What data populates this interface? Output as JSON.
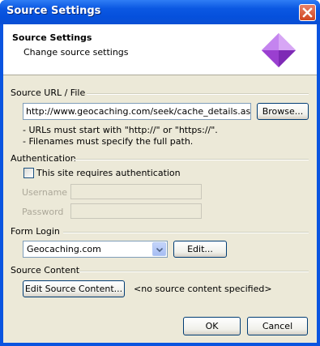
{
  "window": {
    "title": "Source Settings"
  },
  "header": {
    "title": "Source Settings",
    "subtitle": "Change source settings"
  },
  "source": {
    "section_label": "Source URL / File",
    "url_value": "http://www.geocaching.com/seek/cache_details.aspx?g",
    "browse_label": "Browse...",
    "note_1": "- URLs must start with \"http://\" or \"https://\".",
    "note_2": "- Filenames must specify the full path."
  },
  "auth": {
    "section_label": "Authentication",
    "checkbox_label": "This site requires authentication",
    "checked": false,
    "username_label": "Username",
    "password_label": "Password",
    "username_value": "",
    "password_value": ""
  },
  "form_login": {
    "section_label": "Form Login",
    "selected": "Geocaching.com",
    "edit_label": "Edit..."
  },
  "source_content": {
    "section_label": "Source Content",
    "edit_label": "Edit Source Content...",
    "status": "<no source content specified>"
  },
  "footer": {
    "ok_label": "OK",
    "cancel_label": "Cancel"
  },
  "colors": {
    "titlebar": "#0a54e0",
    "dialog_bg": "#ece9d8",
    "close": "#d0451f",
    "gem": "#b66de8"
  },
  "icons": {
    "close": "close-icon",
    "header": "diamond-icon",
    "dropdown": "chevron-down-icon"
  }
}
